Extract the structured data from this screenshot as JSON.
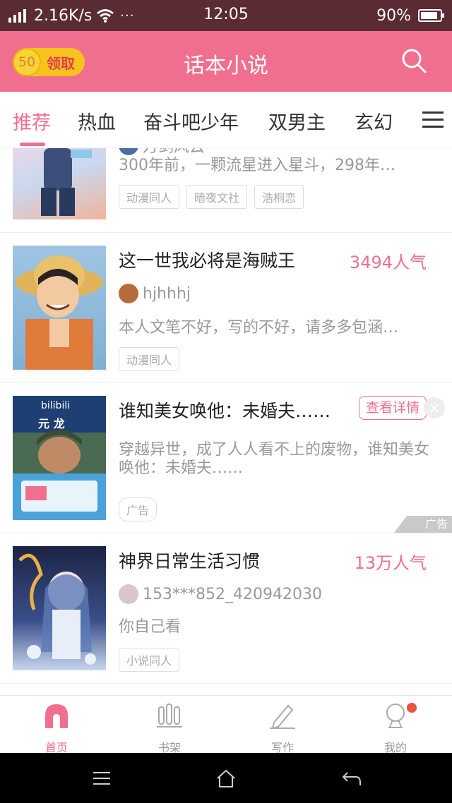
{
  "status_bar": {
    "net_speed": "2.16K/s",
    "extra": "···",
    "time": "12:05",
    "battery": "90%",
    "battery_level": 0.9
  },
  "header": {
    "coin_value": "50",
    "coin_label": "领取",
    "title": "话本小说",
    "search_icon": "search-icon"
  },
  "tabs": [
    {
      "label": "推荐",
      "active": true
    },
    {
      "label": "热血"
    },
    {
      "label": "奋斗吧少年"
    },
    {
      "label": "双男主"
    },
    {
      "label": "玄幻"
    }
  ],
  "feed": [
    {
      "author": "万剑风云",
      "desc": "300年前，一颗流星进入星斗，298年…",
      "tags": [
        "动漫同人",
        "暗夜文社",
        "浩桐恋"
      ]
    },
    {
      "title": "这一世我必将是海贼王",
      "popularity": "3494人气",
      "author": "hjhhhj",
      "desc": "本人文笔不好，写的不好，请多多包涵…",
      "tags": [
        "动漫同人"
      ]
    },
    {
      "title": "谁知美女唤他：未婚夫……",
      "detail_button": "查看详情",
      "close": "×",
      "desc": "穿越异世，成了人人看不上的废物，谁知美女唤他：未婚夫……",
      "tags": [
        "广告"
      ],
      "ad_corner": "广告",
      "cover_text_top": "bilibili",
      "cover_text_mid": "元 龙"
    },
    {
      "title": "神界日常生活习惯",
      "popularity": "13万人气",
      "author": "153***852_420942030",
      "desc": "你自己看",
      "tags": [
        "小说同人"
      ]
    }
  ],
  "bottom_nav": [
    {
      "label": "首页",
      "icon": "home-icon",
      "active": true
    },
    {
      "label": "书架",
      "icon": "bookshelf-icon"
    },
    {
      "label": "写作",
      "icon": "pen-icon"
    },
    {
      "label": "我的",
      "icon": "profile-icon",
      "badge": true
    }
  ],
  "colors": {
    "accent": "#f06f8e",
    "status_bar": "#5a2b33",
    "coin": "#f8c31d"
  }
}
